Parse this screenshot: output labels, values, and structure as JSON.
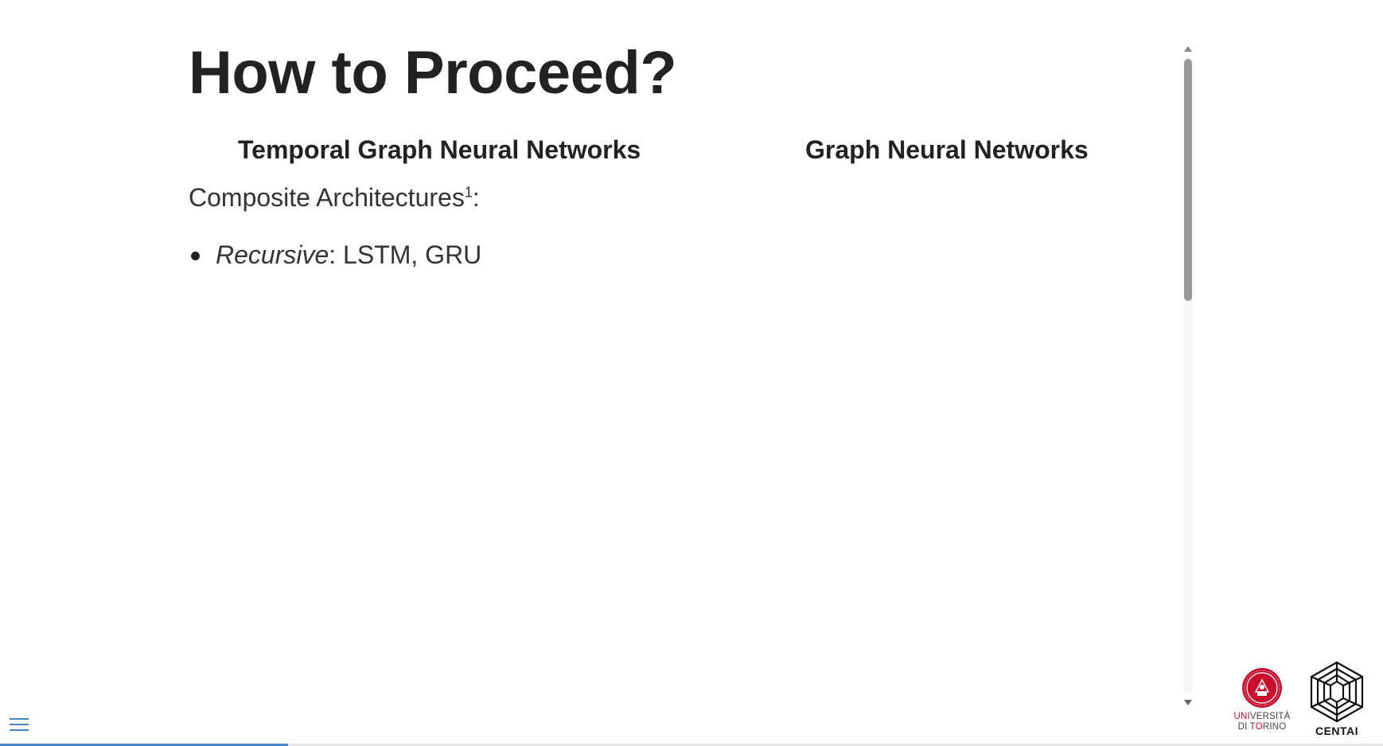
{
  "slide": {
    "title": "How to Proceed?",
    "columns": [
      {
        "heading": "Temporal Graph Neural Networks"
      },
      {
        "heading": "Graph Neural Networks"
      }
    ],
    "intro_text": "Composite Architectures",
    "intro_footnote_mark": "1",
    "intro_suffix": ":",
    "bullets": [
      {
        "emphasis": "Recursive",
        "text": ": LSTM, GRU"
      }
    ]
  },
  "navigation": {
    "menu_icon": "hamburger-menu-icon",
    "progress_fraction": 0.208,
    "accent_color": "#4a84c4"
  },
  "logos": {
    "unito": {
      "line1_red": "UNI",
      "line1_rest": "VERSITÀ",
      "line2_start": "DI T",
      "line2_red": "O",
      "line2_end": "RINO",
      "color": "#c8102e"
    },
    "centai": {
      "label": "CENTAI"
    }
  }
}
